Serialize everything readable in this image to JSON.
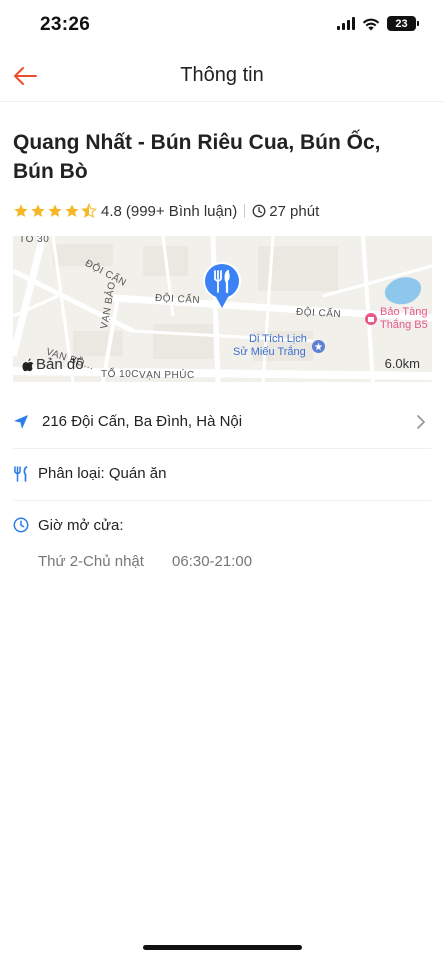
{
  "status_bar": {
    "time": "23:26",
    "battery": "23"
  },
  "nav": {
    "title": "Thông tin",
    "back_icon": "arrow-left-icon"
  },
  "shop": {
    "name": "Quang Nhất - Bún Riêu Cua, Bún Ốc, Bún Bò",
    "rating": {
      "value": "4.8",
      "stars": 4.5,
      "reviews": "(999+ Bình luận)"
    },
    "eta": "27 phút"
  },
  "map": {
    "street_labels": [
      "TÔ 30",
      "ĐỘI CẤN",
      "ĐỘI CẤN",
      "ĐỘI CẤN",
      "VẠN BẢO",
      "VAN BỒ...",
      "TỔ 10C",
      "VẠN PHÚC"
    ],
    "poi_1": [
      "Di Tích Lịch",
      "Sử Miếu Trắng"
    ],
    "poi_2": [
      "Bảo Tàng",
      "Thắng B5"
    ],
    "logo": "Bản đồ",
    "scale": "6.0km"
  },
  "address": "216 Đội Cấn, Ba Đình, Hà Nội",
  "category": "Phân loại: Quán ăn",
  "hours": {
    "label": "Giờ mở cửa:",
    "day": "Thứ 2-Chủ nhật",
    "time": "06:30-21:00"
  },
  "colors": {
    "accent": "#ee4d2d",
    "star": "#f5b727",
    "icon_blue": "#2b7de9",
    "pin_blue": "#3b82f6",
    "poi_pink": "#e8578a"
  }
}
